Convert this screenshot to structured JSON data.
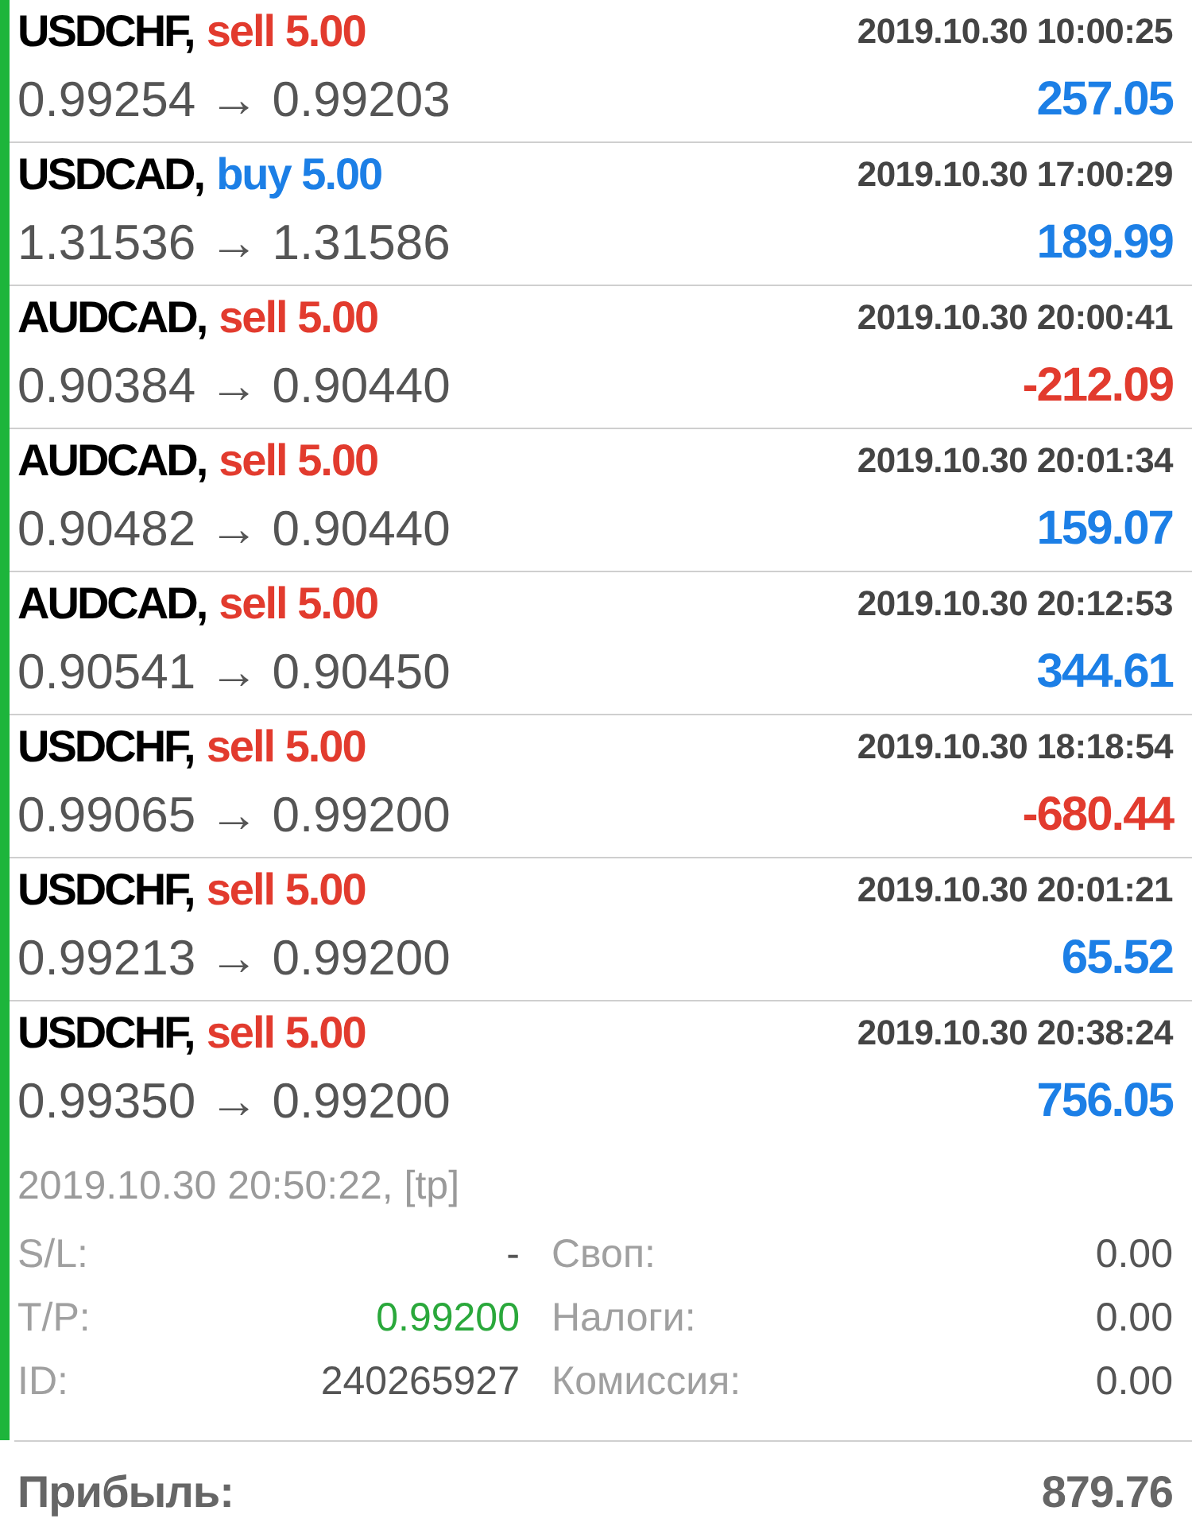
{
  "deals": [
    {
      "symbol": "USDCHF,",
      "order": "sell 5.00",
      "kind": "sell",
      "time": "2019.10.30 10:00:25",
      "prices": "0.99254 → 0.99203",
      "profit": "257.05",
      "loss": false,
      "expanded": false
    },
    {
      "symbol": "USDCAD,",
      "order": "buy 5.00",
      "kind": "buy",
      "time": "2019.10.30 17:00:29",
      "prices": "1.31536 → 1.31586",
      "profit": "189.99",
      "loss": false,
      "expanded": false
    },
    {
      "symbol": "AUDCAD,",
      "order": "sell 5.00",
      "kind": "sell",
      "time": "2019.10.30 20:00:41",
      "prices": "0.90384 → 0.90440",
      "profit": "-212.09",
      "loss": true,
      "expanded": false
    },
    {
      "symbol": "AUDCAD,",
      "order": "sell 5.00",
      "kind": "sell",
      "time": "2019.10.30 20:01:34",
      "prices": "0.90482 → 0.90440",
      "profit": "159.07",
      "loss": false,
      "expanded": false
    },
    {
      "symbol": "AUDCAD,",
      "order": "sell 5.00",
      "kind": "sell",
      "time": "2019.10.30 20:12:53",
      "prices": "0.90541 → 0.90450",
      "profit": "344.61",
      "loss": false,
      "expanded": false
    },
    {
      "symbol": "USDCHF,",
      "order": "sell 5.00",
      "kind": "sell",
      "time": "2019.10.30 18:18:54",
      "prices": "0.99065 → 0.99200",
      "profit": "-680.44",
      "loss": true,
      "expanded": false
    },
    {
      "symbol": "USDCHF,",
      "order": "sell 5.00",
      "kind": "sell",
      "time": "2019.10.30 20:01:21",
      "prices": "0.99213 → 0.99200",
      "profit": "65.52",
      "loss": false,
      "expanded": false
    },
    {
      "symbol": "USDCHF,",
      "order": "sell 5.00",
      "kind": "sell",
      "time": "2019.10.30 20:38:24",
      "prices": "0.99350 → 0.99200",
      "profit": "756.05",
      "loss": false,
      "expanded": true,
      "details": {
        "close_time": "2019.10.30 20:50:22, [tp]",
        "rows": [
          {
            "cells": [
              {
                "text": "S/L:",
                "kind": "label",
                "highlight": false
              },
              {
                "text": "-",
                "kind": "value",
                "highlight": false
              },
              {
                "text": "Своп:",
                "kind": "label",
                "highlight": false
              },
              {
                "text": "0.00",
                "kind": "value",
                "highlight": false
              }
            ]
          },
          {
            "cells": [
              {
                "text": "T/P:",
                "kind": "label",
                "highlight": false
              },
              {
                "text": "0.99200",
                "kind": "value",
                "highlight": true
              },
              {
                "text": "Налоги:",
                "kind": "label",
                "highlight": false
              },
              {
                "text": "0.00",
                "kind": "value",
                "highlight": false
              }
            ]
          },
          {
            "cells": [
              {
                "text": "ID:",
                "kind": "label",
                "highlight": false
              },
              {
                "text": "240265927",
                "kind": "value",
                "highlight": false
              },
              {
                "text": "Комиссия:",
                "kind": "label",
                "highlight": false
              },
              {
                "text": "0.00",
                "kind": "value",
                "highlight": false
              }
            ]
          }
        ]
      }
    }
  ],
  "summary": {
    "label": "Прибыль:",
    "value": "879.76"
  }
}
